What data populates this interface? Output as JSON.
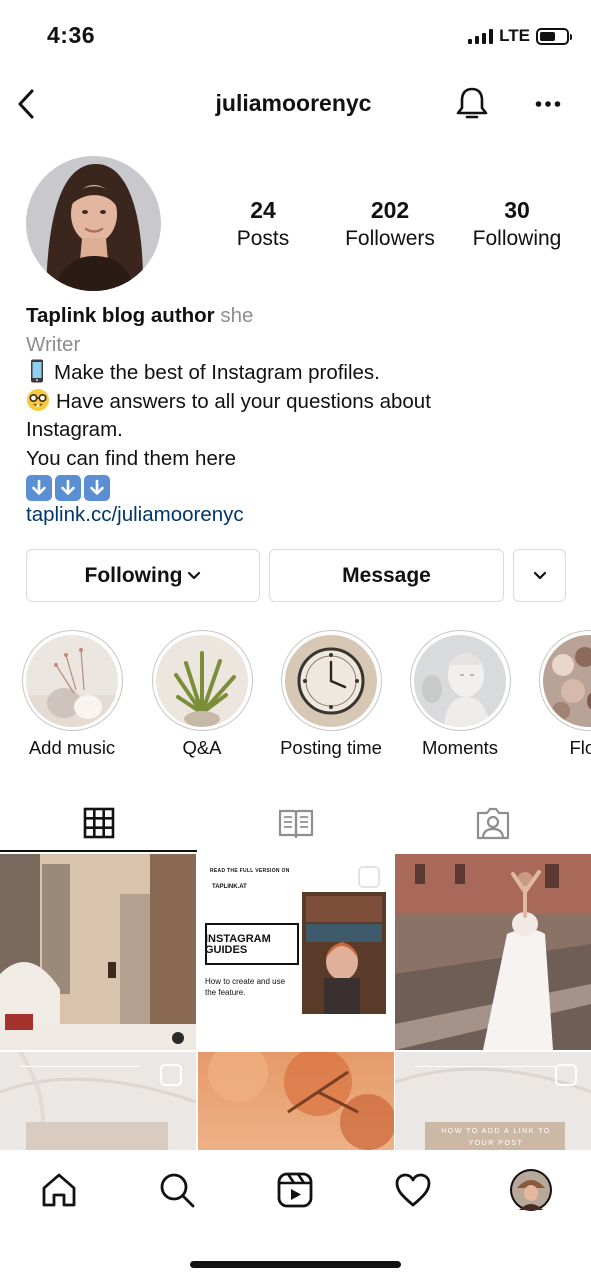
{
  "status": {
    "time": "4:36",
    "network": "LTE"
  },
  "header": {
    "username": "juliamoorenyc"
  },
  "stats": [
    {
      "value": "24",
      "label": "Posts"
    },
    {
      "value": "202",
      "label": "Followers"
    },
    {
      "value": "30",
      "label": "Following"
    }
  ],
  "bio": {
    "name": "Taplink blog author",
    "pronoun": "she",
    "category": "Writer",
    "line1": "Make the best of Instagram profiles.",
    "line2": "Have answers to all your questions about",
    "line3": "Instagram.",
    "line4": "You can find them here",
    "link": "taplink.cc/juliamoorenyc"
  },
  "buttons": {
    "following": "Following",
    "message": "Message"
  },
  "highlights": [
    {
      "label": "Add music"
    },
    {
      "label": "Q&A"
    },
    {
      "label": "Posting time"
    },
    {
      "label": "Moments"
    },
    {
      "label": "Flow"
    }
  ],
  "posts": {
    "guide_top": "READ THE FULL VERSION ON",
    "guide_site": "TAPLINK.AT",
    "guide_title1": "INSTAGRAM",
    "guide_title2": "GUIDES",
    "guide_sub": "How to create and use the feature.",
    "link_post_title": "HOW TO ADD A LINK TO YOUR POST"
  },
  "colors": {
    "link": "#00376b",
    "secondary_text": "#8e8e8e",
    "border": "#dbdbdb"
  }
}
